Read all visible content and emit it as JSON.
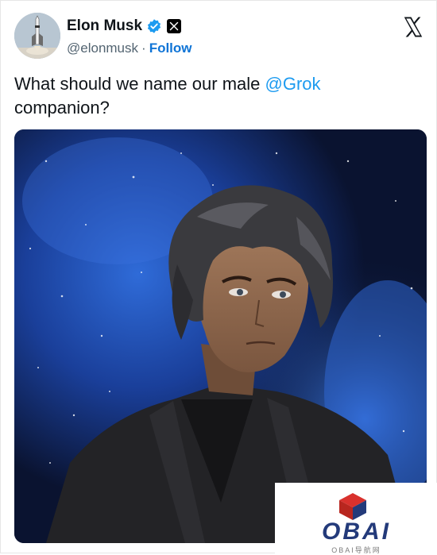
{
  "author": {
    "name": "Elon Musk",
    "handle": "@elonmusk",
    "separator": "·",
    "follow_label": "Follow"
  },
  "tweet": {
    "text_before": "What should we name our male ",
    "mention": "@Grok",
    "text_after": " companion?"
  },
  "media": {
    "description_icon": "anime-man-portrait"
  },
  "watermark": {
    "brand": "OBAI",
    "subtitle": "OBAI导航网"
  },
  "icons": {
    "verified": "verified-badge-icon",
    "x_badge": "x-affiliate-icon",
    "x_logo": "x-logo-icon"
  },
  "colors": {
    "accent": "#1d9bf0",
    "follow": "#0f74d6",
    "muted": "#536471"
  }
}
